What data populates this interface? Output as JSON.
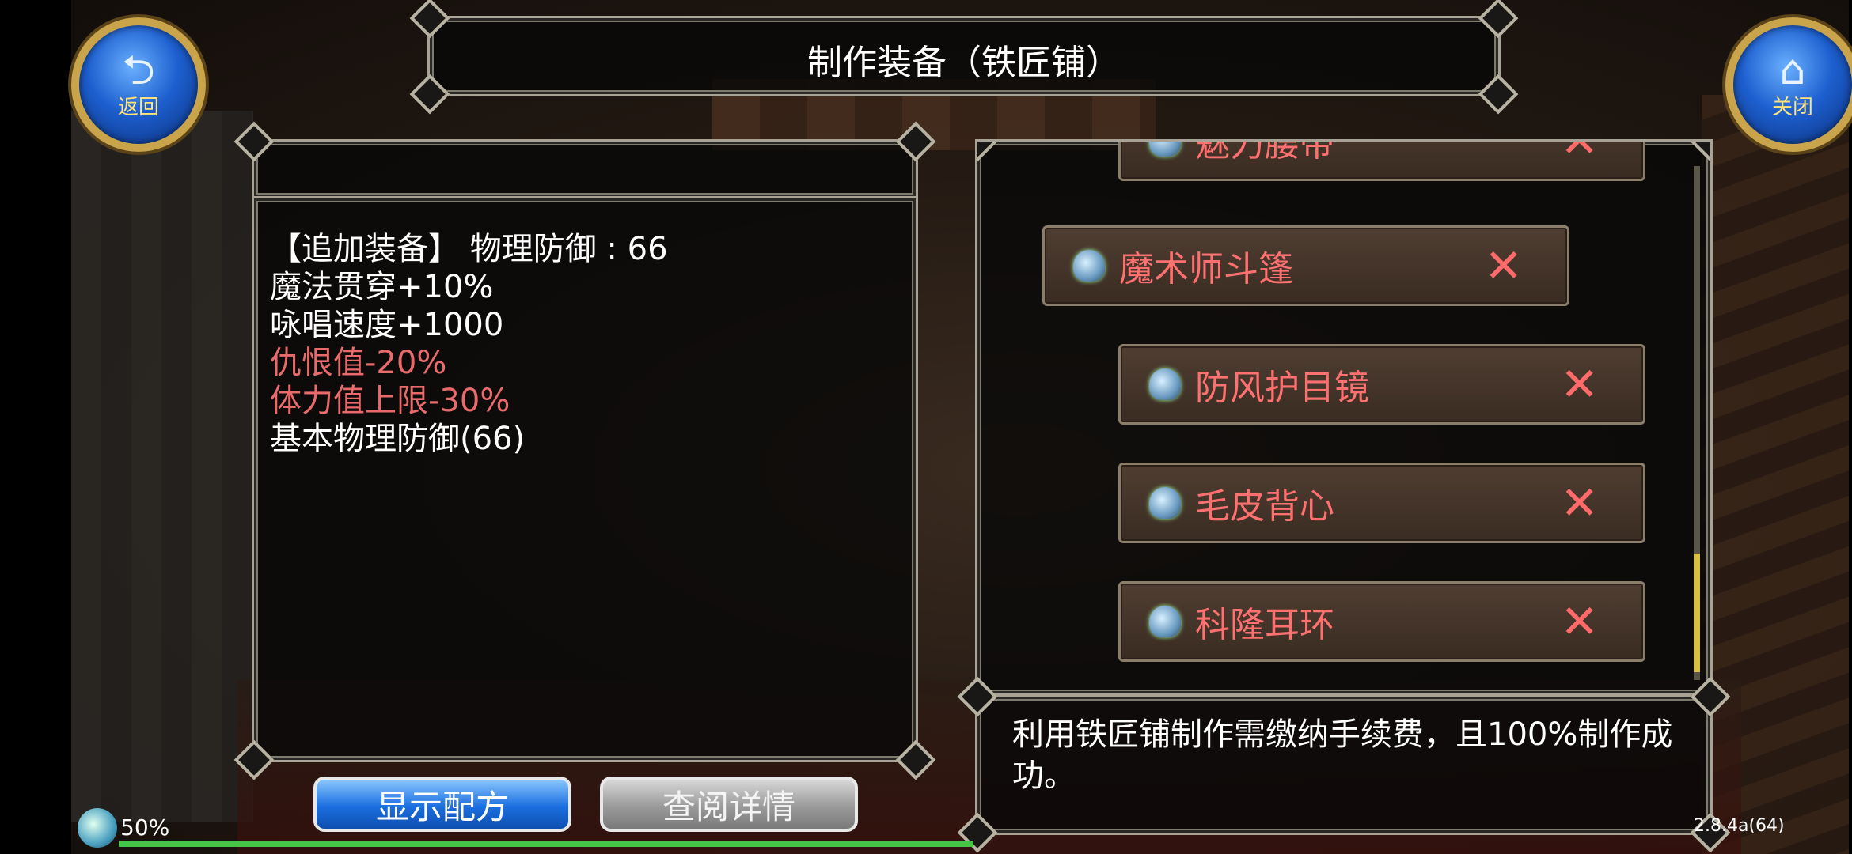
{
  "nav": {
    "back_label": "返回",
    "close_label": "关闭"
  },
  "title": "制作装备（铁匠铺）",
  "stats": [
    {
      "text": "【追加装备】 物理防御 :  66",
      "color": "white"
    },
    {
      "text": "魔法贯穿+10%",
      "color": "white"
    },
    {
      "text": "咏唱速度+1000",
      "color": "white"
    },
    {
      "text": "仇恨值-20%",
      "color": "red"
    },
    {
      "text": "体力值上限-30%",
      "color": "red"
    },
    {
      "text": "基本物理防御(66)",
      "color": "white"
    }
  ],
  "recipes": [
    {
      "name": "魅力腰带",
      "icon": "hat-icon",
      "available": false
    },
    {
      "name": "魔术师斗篷",
      "icon": "hat-icon",
      "available": false,
      "selected": true
    },
    {
      "name": "防风护目镜",
      "icon": "hat-icon",
      "available": false
    },
    {
      "name": "毛皮背心",
      "icon": "hat-icon",
      "available": false
    },
    {
      "name": "科隆耳环",
      "icon": "hat-icon",
      "available": false
    }
  ],
  "description": "利用铁匠铺制作需缴纳手续费，且100%制作成功。",
  "buttons": {
    "show_recipe": "显示配方",
    "view_details": "查阅详情"
  },
  "status": {
    "percent_label": "50%",
    "version": "2.8.4a(64)"
  },
  "colors": {
    "stat_red": "#e86a6a",
    "recipe_name": "#ff7070",
    "button_blue": "#1b6fe0",
    "frame_border": "#a8a396"
  }
}
